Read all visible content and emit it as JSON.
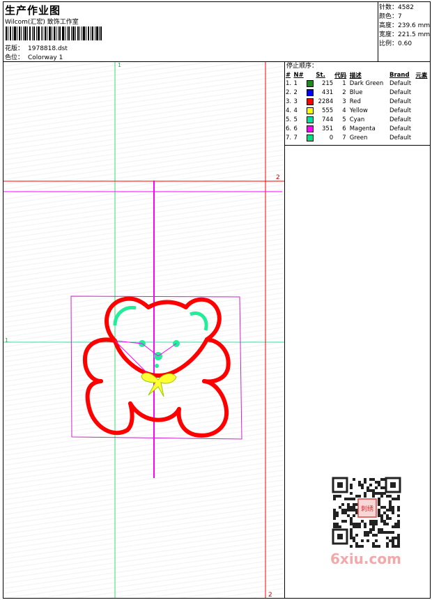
{
  "header": {
    "title": "生产作业图",
    "subtitle": "Wilcom(汇宏) 致饰工作室",
    "design_label": "花版：",
    "design_value": "1978818.dst",
    "colorway_label": "色位：",
    "colorway_value": "Colorway 1"
  },
  "stats": [
    {
      "label": "针数：",
      "value": "4582"
    },
    {
      "label": "颜色：",
      "value": "7"
    },
    {
      "label": "高度：",
      "value": "239.6 mm"
    },
    {
      "label": "宽度：",
      "value": "221.5 mm"
    },
    {
      "label": "比例：",
      "value": "0.60"
    }
  ],
  "stop_sequence": {
    "title": "停止顺序：",
    "columns": [
      "#",
      "N#",
      "St.",
      "代码",
      "描述",
      "Brand",
      "元素"
    ],
    "rows": [
      {
        "idx": "1.",
        "n": "1",
        "color": "#1a8a1a",
        "st": "215",
        "code": "1",
        "desc": "Dark Green",
        "brand": "Default"
      },
      {
        "idx": "2.",
        "n": "2",
        "color": "#0000ff",
        "st": "431",
        "code": "2",
        "desc": "Blue",
        "brand": "Default"
      },
      {
        "idx": "3.",
        "n": "3",
        "color": "#ff0000",
        "st": "2284",
        "code": "3",
        "desc": "Red",
        "brand": "Default"
      },
      {
        "idx": "4.",
        "n": "4",
        "color": "#ffff00",
        "st": "555",
        "code": "4",
        "desc": "Yellow",
        "brand": "Default"
      },
      {
        "idx": "5.",
        "n": "5",
        "color": "#00e0a0",
        "st": "744",
        "code": "5",
        "desc": "Cyan",
        "brand": "Default"
      },
      {
        "idx": "6.",
        "n": "6",
        "color": "#ff00ff",
        "st": "351",
        "code": "6",
        "desc": "Magenta",
        "brand": "Default"
      },
      {
        "idx": "7.",
        "n": "7",
        "color": "#00e080",
        "st": "0",
        "code": "7",
        "desc": "Green",
        "brand": "Default"
      }
    ]
  },
  "guides": {
    "green_label": "1",
    "red_label": "2"
  },
  "watermark": "6xiu.com",
  "qr_seal": "刺绣"
}
